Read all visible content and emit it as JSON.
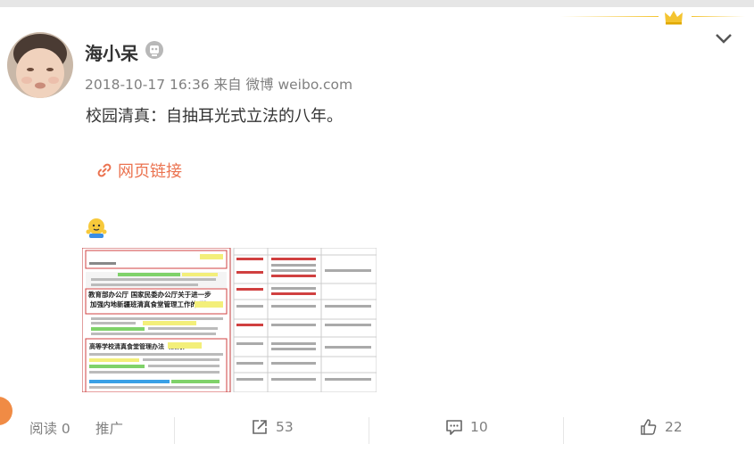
{
  "post": {
    "username": "海小呆",
    "meta": "2018-10-17 16:36 来自 微博 weibo.com",
    "text": "校园清真：自抽耳光式立法的八年。",
    "link_label": "网页链接"
  },
  "footer": {
    "read_label": "阅读 0",
    "promote_label": "推广",
    "repost_count": "53",
    "comment_count": "10",
    "like_count": "22"
  },
  "attachment": {
    "left_lines": {
      "heading": "教育部办公厅 国家民委办公厅关于进一步",
      "subheading": "加强内地新疆班清真食堂管理工作的通知",
      "section": "高等学校清真食堂管理办法（试行）"
    }
  },
  "colors": {
    "accent": "#eb7350",
    "muted": "#808080",
    "gold": "#f4c430"
  },
  "icons": [
    "crown-icon",
    "chevron-down-icon",
    "vip-badge-icon",
    "link-icon",
    "emoji-icon",
    "repost-icon",
    "comment-icon",
    "like-icon"
  ]
}
